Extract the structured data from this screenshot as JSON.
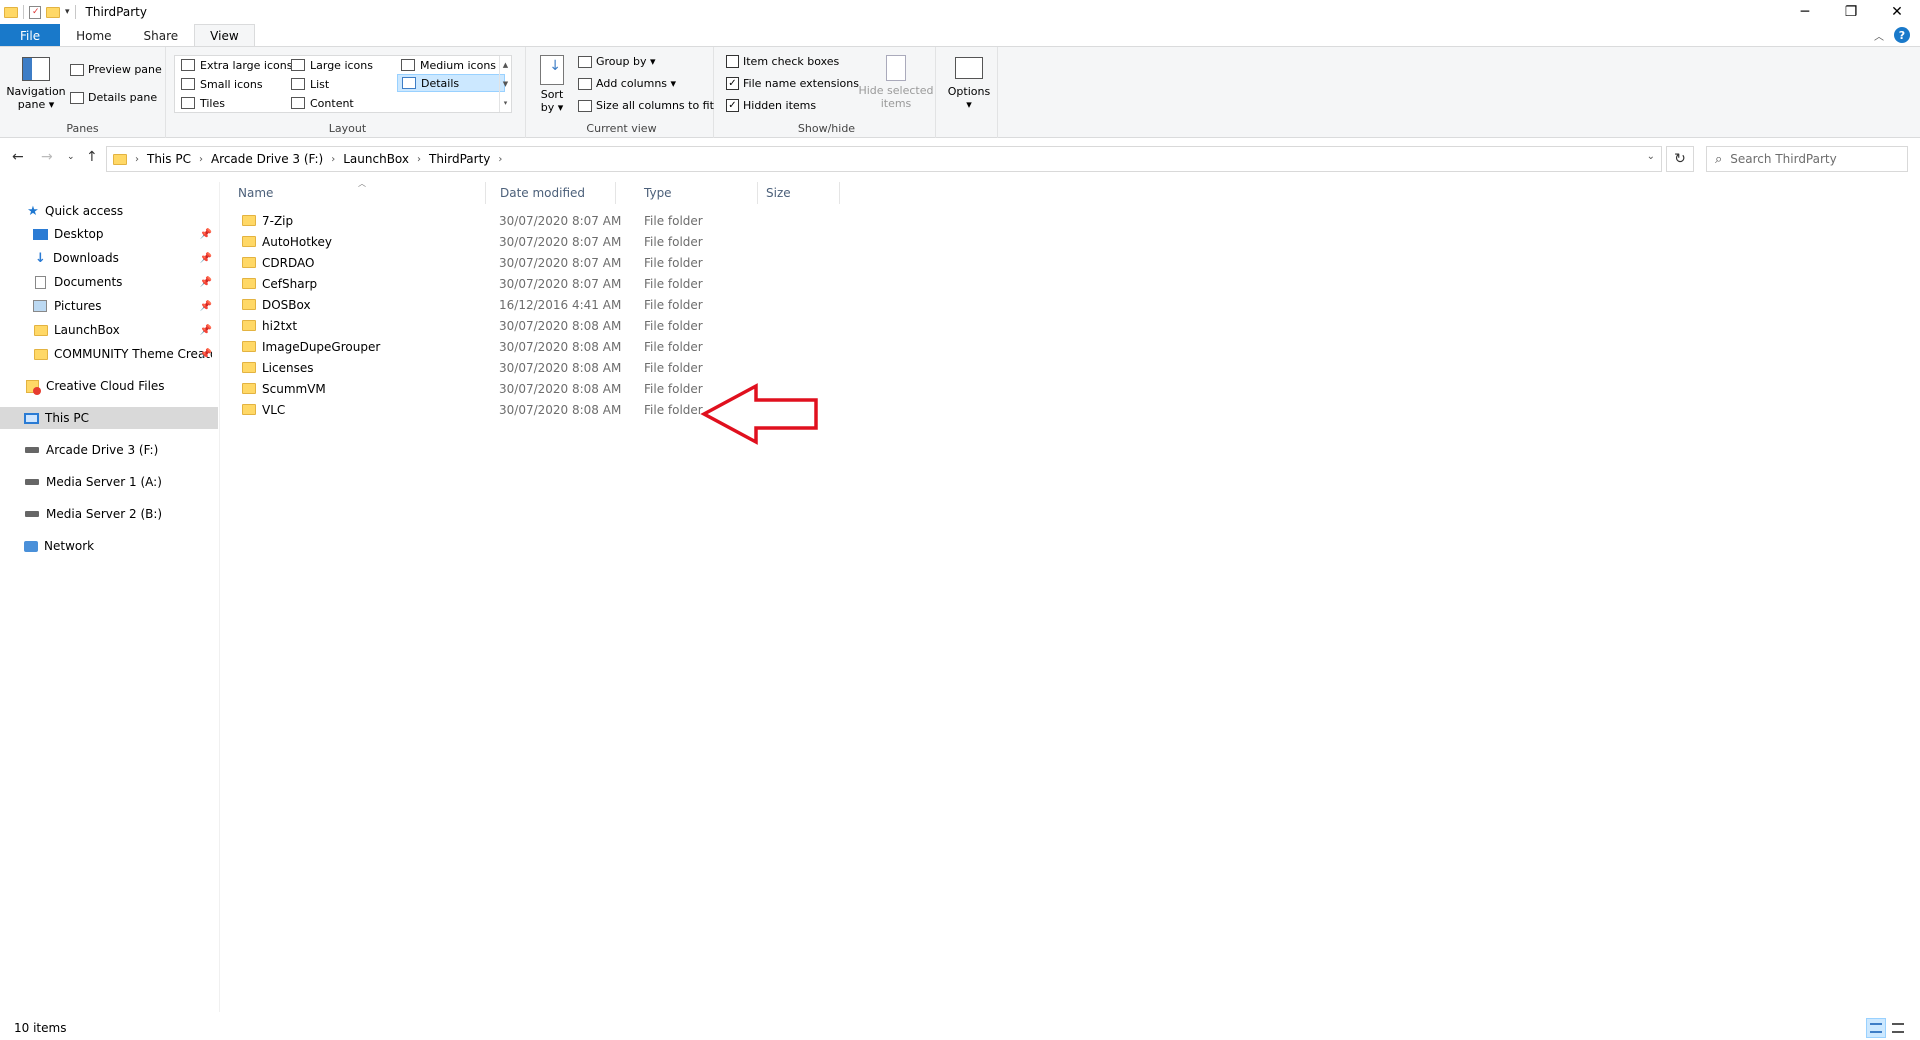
{
  "window": {
    "title": "ThirdParty",
    "minimize": "─",
    "restore": "❐",
    "close": "✕"
  },
  "tabs": [
    {
      "label": "File"
    },
    {
      "label": "Home"
    },
    {
      "label": "Share"
    },
    {
      "label": "View"
    }
  ],
  "ribbon": {
    "panes": {
      "navigation_pane": "Navigation",
      "navigation_pane_2": "pane ▾",
      "preview_pane": "Preview pane",
      "details_pane": "Details pane",
      "label": "Panes"
    },
    "layout": {
      "items": [
        "Extra large icons",
        "Large icons",
        "Medium icons",
        "Small icons",
        "List",
        "Details",
        "Tiles",
        "Content"
      ],
      "selected": "Details",
      "label": "Layout"
    },
    "current_view": {
      "sort_by": "Sort",
      "sort_by_2": "by ▾",
      "group_by": "Group by ▾",
      "add_columns": "Add columns ▾",
      "size_all_columns": "Size all columns to fit",
      "label": "Current view"
    },
    "show_hide": {
      "item_check_boxes": "Item check boxes",
      "item_check_boxes_checked": false,
      "file_name_extensions": "File name extensions",
      "file_name_extensions_checked": true,
      "hidden_items": "Hidden items",
      "hidden_items_checked": true,
      "hide_selected": "Hide selected",
      "hide_selected_2": "items",
      "label": "Show/hide"
    },
    "options": {
      "label": "Options",
      "dropdown": "▾"
    }
  },
  "address": {
    "crumbs": [
      "This PC",
      "Arcade Drive 3 (F:)",
      "LaunchBox",
      "ThirdParty"
    ],
    "search_placeholder": "Search ThirdParty"
  },
  "nav": {
    "quick_access": "Quick access",
    "pinned": [
      {
        "label": "Desktop",
        "icon": "desktop-icon"
      },
      {
        "label": "Downloads",
        "icon": "downloads-icon"
      },
      {
        "label": "Documents",
        "icon": "documents-icon"
      },
      {
        "label": "Pictures",
        "icon": "pictures-icon"
      },
      {
        "label": "LaunchBox",
        "icon": "folder-icon"
      },
      {
        "label": "COMMUNITY Theme Creato",
        "icon": "folder-icon"
      }
    ],
    "creative_cloud": "Creative Cloud Files",
    "this_pc": "This PC",
    "drives": [
      {
        "label": "Arcade Drive 3 (F:)"
      },
      {
        "label": "Media Server 1 (A:)"
      },
      {
        "label": "Media Server 2 (B:)"
      }
    ],
    "network": "Network"
  },
  "columns": {
    "name": "Name",
    "date_modified": "Date modified",
    "type": "Type",
    "size": "Size"
  },
  "files": [
    {
      "name": "7-Zip",
      "date": "30/07/2020 8:07 AM",
      "type": "File folder"
    },
    {
      "name": "AutoHotkey",
      "date": "30/07/2020 8:07 AM",
      "type": "File folder"
    },
    {
      "name": "CDRDAO",
      "date": "30/07/2020 8:07 AM",
      "type": "File folder"
    },
    {
      "name": "CefSharp",
      "date": "30/07/2020 8:07 AM",
      "type": "File folder"
    },
    {
      "name": "DOSBox",
      "date": "16/12/2016 4:41 AM",
      "type": "File folder"
    },
    {
      "name": "hi2txt",
      "date": "30/07/2020 8:08 AM",
      "type": "File folder"
    },
    {
      "name": "ImageDupeGrouper",
      "date": "30/07/2020 8:08 AM",
      "type": "File folder"
    },
    {
      "name": "Licenses",
      "date": "30/07/2020 8:08 AM",
      "type": "File folder"
    },
    {
      "name": "ScummVM",
      "date": "30/07/2020 8:08 AM",
      "type": "File folder"
    },
    {
      "name": "VLC",
      "date": "30/07/2020 8:08 AM",
      "type": "File folder"
    }
  ],
  "status": {
    "item_count": "10 items"
  },
  "colors": {
    "accent": "#1979ca",
    "annotation_arrow": "#e0101e",
    "folder": "#ffd866"
  }
}
